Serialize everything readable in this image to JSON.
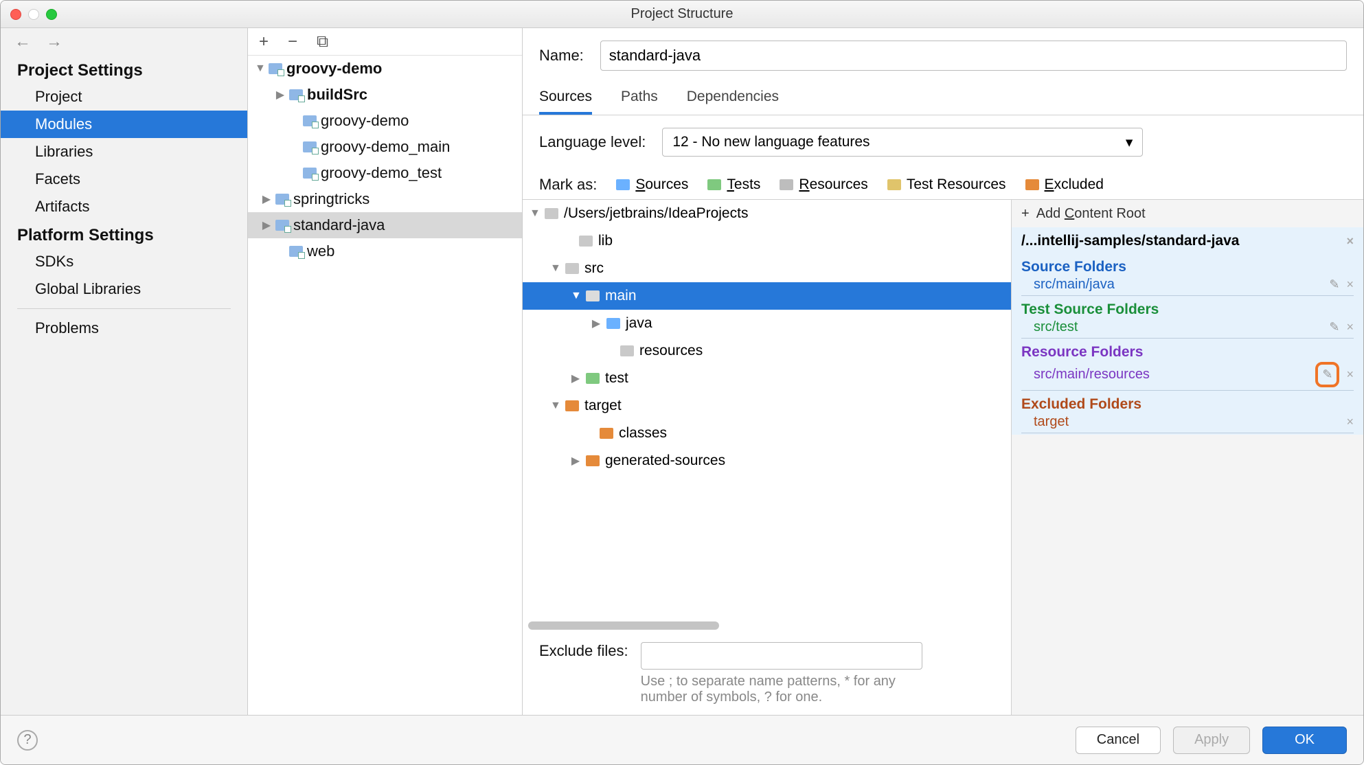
{
  "window": {
    "title": "Project Structure"
  },
  "sidebar": {
    "headers": {
      "project": "Project Settings",
      "platform": "Platform Settings"
    },
    "items": {
      "project": "Project",
      "modules": "Modules",
      "libraries": "Libraries",
      "facets": "Facets",
      "artifacts": "Artifacts",
      "sdks": "SDKs",
      "globals": "Global Libraries",
      "problems": "Problems"
    }
  },
  "modules": {
    "groovy_demo": "groovy-demo",
    "buildSrc": "buildSrc",
    "gd": "groovy-demo",
    "gd_main": "groovy-demo_main",
    "gd_test": "groovy-demo_test",
    "springtricks": "springtricks",
    "standard_java": "standard-java",
    "web": "web"
  },
  "form": {
    "name_label": "Name:",
    "name_value": "standard-java",
    "tabs": {
      "sources": "Sources",
      "paths": "Paths",
      "deps": "Dependencies"
    },
    "lang_label": "Language level:",
    "lang_value": "12 - No new language features",
    "mark_label": "Mark as:",
    "mark": {
      "sources": "Sources",
      "tests": "Tests",
      "resources": "Resources",
      "tresources": "Test Resources",
      "excluded": "Excluded"
    }
  },
  "tree": {
    "root": "/Users/jetbrains/IdeaProjects",
    "lib": "lib",
    "src": "src",
    "main": "main",
    "java": "java",
    "resources": "resources",
    "test": "test",
    "target": "target",
    "classes": "classes",
    "generated": "generated-sources"
  },
  "contentroot": {
    "add": "Add Content Root",
    "path": "/...intellij-samples/standard-java",
    "source_hdr": "Source Folders",
    "source_1": "src/main/java",
    "test_hdr": "Test Source Folders",
    "test_1": "src/test",
    "res_hdr": "Resource Folders",
    "res_1": "src/main/resources",
    "exc_hdr": "Excluded Folders",
    "exc_1": "target"
  },
  "exclude": {
    "label": "Exclude files:",
    "help": "Use ; to separate name patterns, * for any number of symbols, ? for one."
  },
  "footer": {
    "cancel": "Cancel",
    "apply": "Apply",
    "ok": "OK"
  },
  "underline": {
    "C": "C",
    "S": "S",
    "T": "T",
    "R": "R",
    "E": "E"
  }
}
